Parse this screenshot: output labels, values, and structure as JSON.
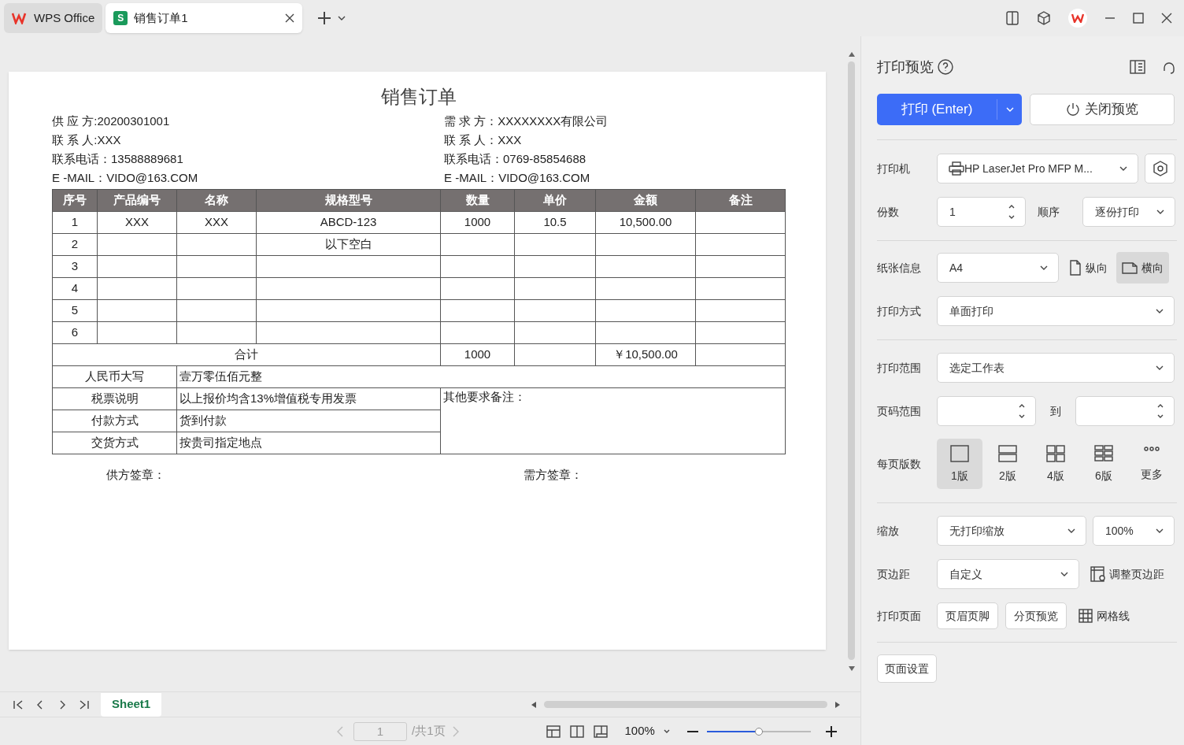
{
  "tabs": [
    {
      "label": "WPS Office",
      "kind": "home",
      "selected": false
    },
    {
      "label": "销售订单1",
      "kind": "sheet",
      "badge": "S",
      "selected": true
    }
  ],
  "document": {
    "title": "销售订单",
    "info_left": [
      "供 应 方:20200301001",
      "联  系  人:XXX",
      "联系电话：13588889681",
      "E -MAIL：VIDO@163.COM"
    ],
    "info_right": [
      "需  求  方：XXXXXXXX有限公司",
      "联  系  人：XXX",
      "联系电话：0769-85854688",
      "E -MAIL：VIDO@163.COM"
    ],
    "columns": [
      "序号",
      "产品编号",
      "名称",
      "规格型号",
      "数量",
      "单价",
      "金额",
      "备注"
    ],
    "rows": [
      [
        "1",
        "XXX",
        "XXX",
        "ABCD-123",
        "1000",
        "10.5",
        "10,500.00",
        ""
      ],
      [
        "2",
        "",
        "",
        "以下空白",
        "",
        "",
        "",
        ""
      ],
      [
        "3",
        "",
        "",
        "",
        "",
        "",
        "",
        ""
      ],
      [
        "4",
        "",
        "",
        "",
        "",
        "",
        "",
        ""
      ],
      [
        "5",
        "",
        "",
        "",
        "",
        "",
        "",
        ""
      ],
      [
        "6",
        "",
        "",
        "",
        "",
        "",
        "",
        ""
      ]
    ],
    "total": {
      "label": "合计",
      "quantity": "1000",
      "amount": "￥10,500.00"
    },
    "amount_in_words": {
      "label": "人民币大写",
      "value": "壹万零伍佰元整"
    },
    "terms": [
      {
        "label": "税票说明",
        "value": "以上报价均含13%增值税专用发票"
      },
      {
        "label": "付款方式",
        "value": "货到付款"
      },
      {
        "label": "交货方式",
        "value": "按贵司指定地点"
      }
    ],
    "remarks": "其他要求备注：",
    "signatures": [
      "供方签章：",
      "需方签章："
    ]
  },
  "panel": {
    "title": "打印预览",
    "print_button": "打印 (Enter)",
    "close_button": "关闭预览",
    "printer": {
      "label": "打印机",
      "value": "HP LaserJet Pro MFP M..."
    },
    "copies": {
      "label": "份数",
      "value": "1"
    },
    "order": {
      "label": "顺序",
      "value": "逐份打印"
    },
    "paper": {
      "label": "纸张信息",
      "value": "A4"
    },
    "orientation": [
      {
        "label": "纵向",
        "kind": "portrait",
        "selected": false
      },
      {
        "label": "横向",
        "kind": "landscape",
        "selected": true
      }
    ],
    "print_mode": {
      "label": "打印方式",
      "value": "单面打印"
    },
    "print_range": {
      "label": "打印范围",
      "value": "选定工作表"
    },
    "page_range": {
      "label": "页码范围",
      "to": "到"
    },
    "pages_per_sheet": {
      "label": "每页版数",
      "options": [
        {
          "label": "1版",
          "kind": "one",
          "selected": true
        },
        {
          "label": "2版",
          "kind": "two",
          "selected": false
        },
        {
          "label": "4版",
          "kind": "four",
          "selected": false
        },
        {
          "label": "6版",
          "kind": "six",
          "selected": false
        },
        {
          "label": "更多",
          "kind": "more",
          "selected": false
        }
      ]
    },
    "scaling": {
      "label": "缩放",
      "value": "无打印缩放",
      "percent": "100%"
    },
    "margins": {
      "label": "页边距",
      "value": "自定义",
      "adjust": "调整页边距"
    },
    "print_page": {
      "label": "打印页面",
      "buttons": [
        "页眉页脚",
        "分页预览"
      ],
      "gridlines": "网格线"
    },
    "page_setup": "页面设置"
  },
  "sheet_tabs": [
    {
      "label": "Sheet1",
      "selected": true
    }
  ],
  "status_bar": {
    "page": "1",
    "page_total": "/共1页",
    "zoom": "100%",
    "zoom_slider": {
      "level": 0.5
    }
  }
}
